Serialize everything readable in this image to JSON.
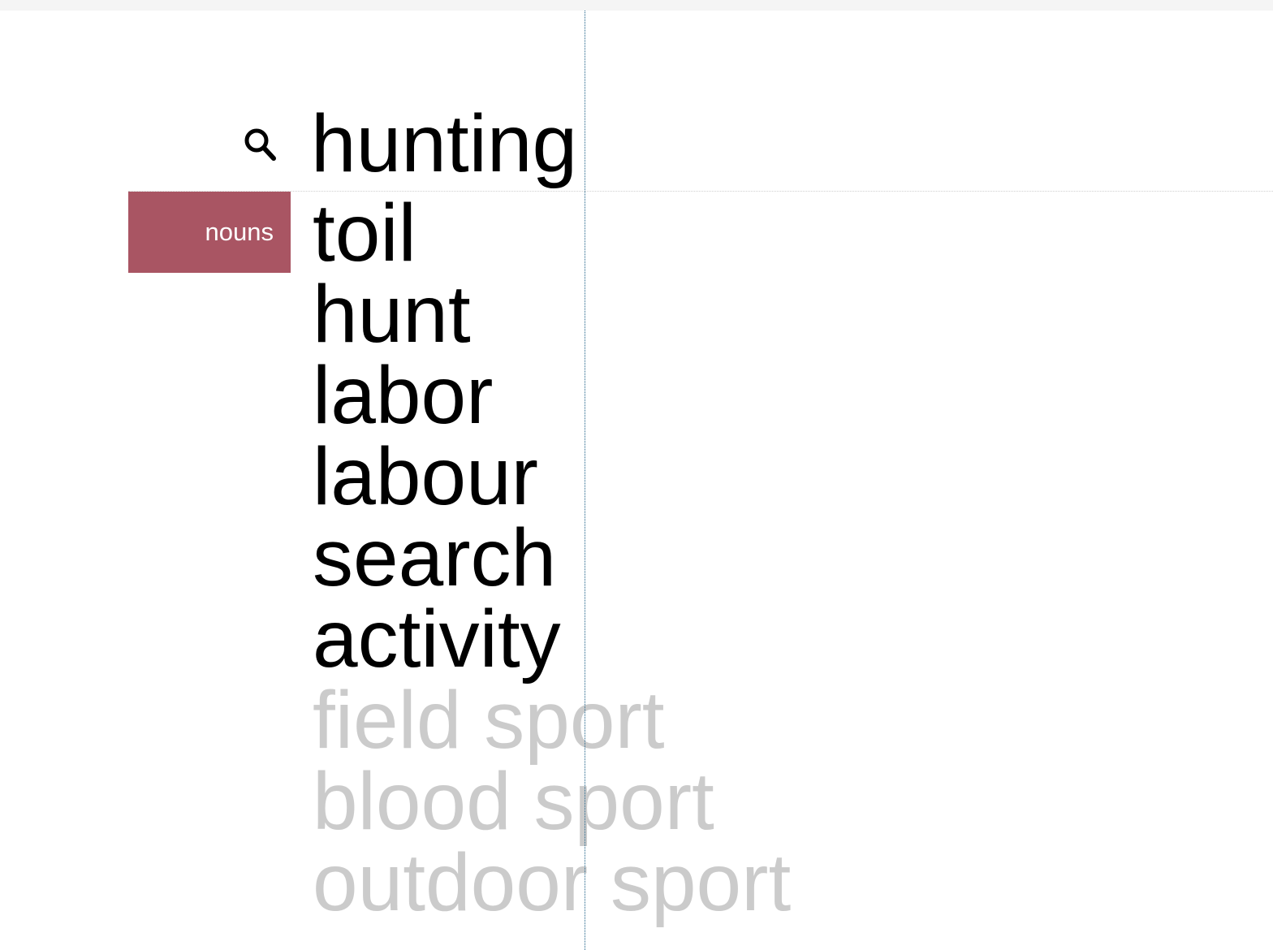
{
  "search": {
    "query": "hunting",
    "icon": "search-icon"
  },
  "part_of_speech": {
    "label": "nouns",
    "color": "#a95563"
  },
  "synonyms": [
    "toil",
    "hunt",
    "labor",
    "labour",
    "search",
    "activity"
  ],
  "related_terms": [
    "field sport",
    "blood sport",
    "outdoor sport"
  ],
  "colors": {
    "primary_text": "#000000",
    "related_text": "#cbcbcb",
    "guide_line": "#1b5f86"
  }
}
